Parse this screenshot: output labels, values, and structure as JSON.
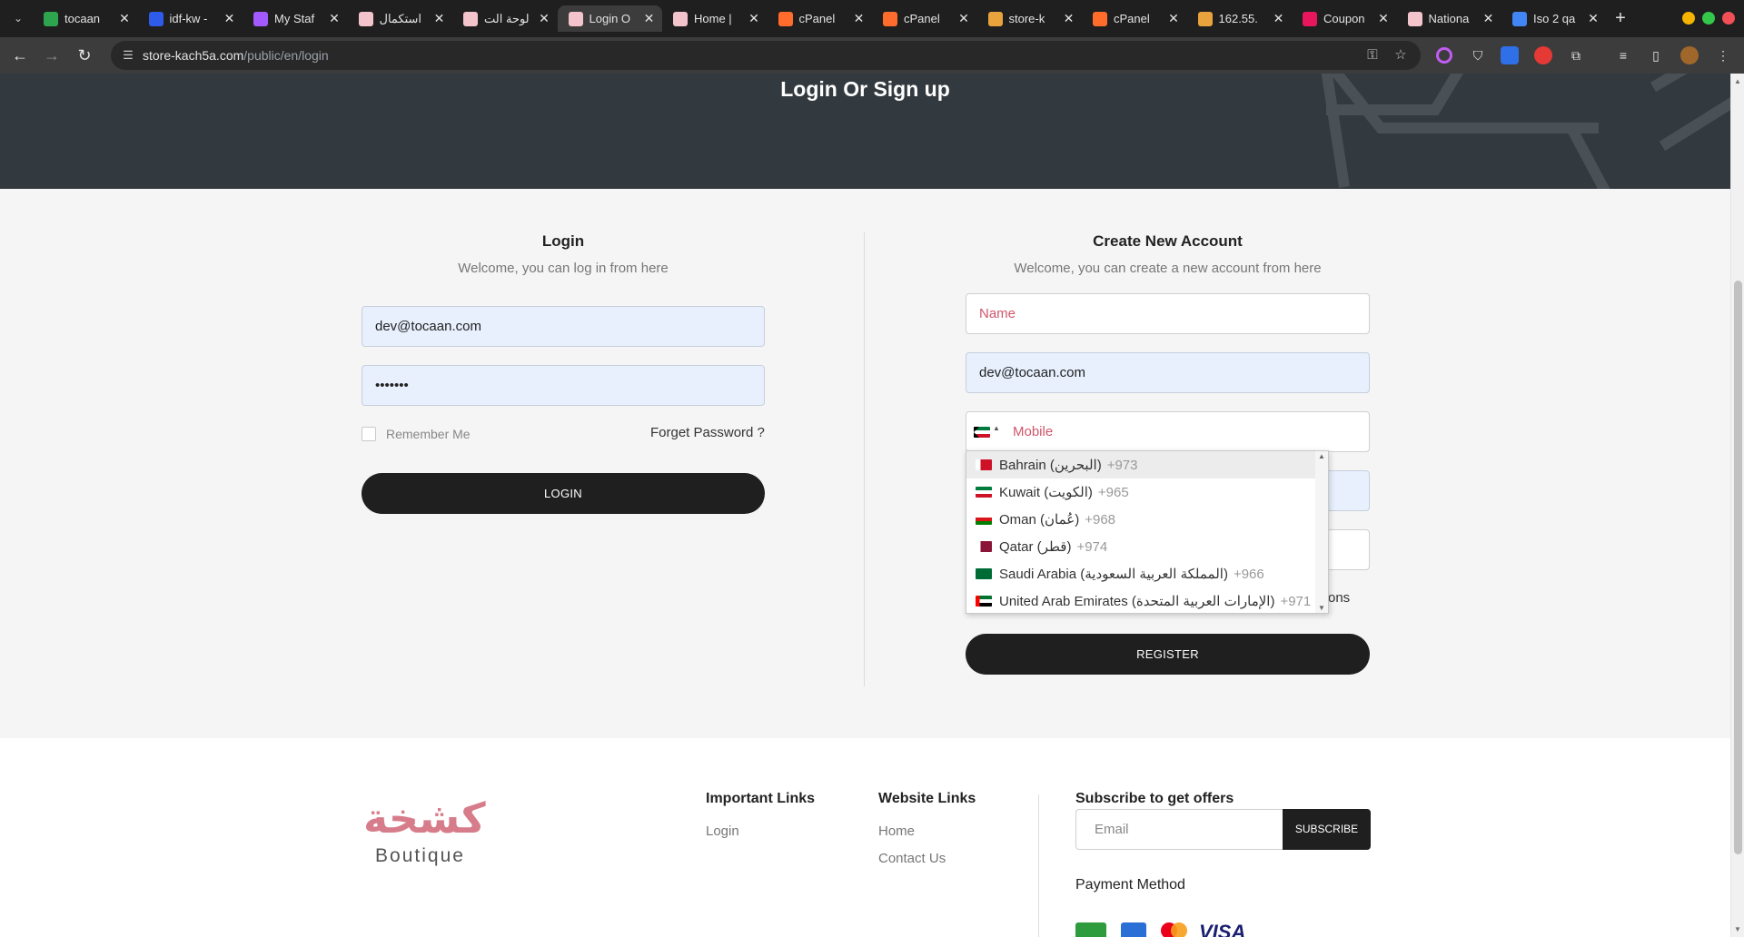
{
  "browser": {
    "tabs": [
      {
        "title": "tocaan",
        "favicon_color": "#2ea44f",
        "active": false
      },
      {
        "title": "idf-kw -",
        "favicon_color": "#2f5bea",
        "active": false
      },
      {
        "title": "My Staf",
        "favicon_color": "#a259ff",
        "active": false
      },
      {
        "title": "استكمال",
        "favicon_color": "#f4c4cc",
        "active": false
      },
      {
        "title": "لوحة الت",
        "favicon_color": "#f4c4cc",
        "active": false
      },
      {
        "title": "Login O",
        "favicon_color": "#f4c4cc",
        "active": true
      },
      {
        "title": "Home |",
        "favicon_color": "#f4c4cc",
        "active": false
      },
      {
        "title": "cPanel",
        "favicon_color": "#ff6c2c",
        "active": false
      },
      {
        "title": "cPanel",
        "favicon_color": "#ff6c2c",
        "active": false
      },
      {
        "title": "store-k",
        "favicon_color": "#e8a33d",
        "active": false
      },
      {
        "title": "cPanel",
        "favicon_color": "#ff6c2c",
        "active": false
      },
      {
        "title": "162.55.",
        "favicon_color": "#e8a33d",
        "active": false
      },
      {
        "title": "Coupon",
        "favicon_color": "#e8175d",
        "active": false
      },
      {
        "title": "Nationa",
        "favicon_color": "#f4c4cc",
        "active": false
      },
      {
        "title": "Iso 2 qa",
        "favicon_color": "#4285f4",
        "active": false
      }
    ],
    "new_tab_label": "+",
    "close_label": "✕",
    "url_domain": "store-kach5a.com",
    "url_path": "/public/en/login"
  },
  "hero": {
    "title": "Login Or Sign up"
  },
  "login": {
    "title": "Login",
    "subtitle": "Welcome, you can log in from here",
    "email_value": "dev@tocaan.com",
    "password_value": "•••••••",
    "remember_label": "Remember Me",
    "forgot_label": "Forget Password ?",
    "button_label": "LOGIN"
  },
  "register": {
    "title": "Create New Account",
    "subtitle": "Welcome, you can create a new account from here",
    "name_placeholder": "Name",
    "email_value": "dev@tocaan.com",
    "mobile_placeholder": "Mobile",
    "terms_tail": "ons",
    "button_label": "REGISTER",
    "countries": [
      {
        "name": "Bahrain (البحرين)",
        "dial": "+973",
        "highlighted": true
      },
      {
        "name": "Kuwait (الكويت)",
        "dial": "+965",
        "highlighted": false
      },
      {
        "name": "Oman (عُمان)",
        "dial": "+968",
        "highlighted": false
      },
      {
        "name": "Qatar (قطر)",
        "dial": "+974",
        "highlighted": false
      },
      {
        "name": "Saudi Arabia (المملكة العربية السعودية)",
        "dial": "+966",
        "highlighted": false
      },
      {
        "name": "United Arab Emirates (الإمارات العربية المتحدة)",
        "dial": "+971",
        "highlighted": false
      }
    ]
  },
  "footer": {
    "logo_arabic": "كشخة",
    "logo_latin": "Boutique",
    "important_links_title": "Important Links",
    "important_links": [
      "Login"
    ],
    "website_links_title": "Website Links",
    "website_links": [
      "Home",
      "Contact Us"
    ],
    "subscribe_title": "Subscribe to get offers",
    "email_placeholder": "Email",
    "subscribe_button": "SUBSCRIBE",
    "payment_title": "Payment Method",
    "payment_visa": "VISA"
  },
  "colors": {
    "brand_pink": "#d0566b",
    "dark": "#1f1f1f",
    "hero_bg": "#333a3f"
  }
}
